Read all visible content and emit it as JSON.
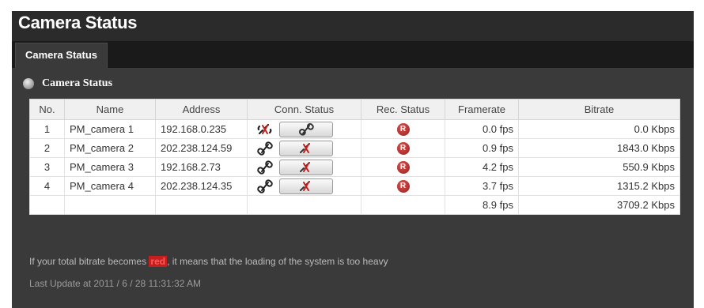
{
  "app": {
    "title": "Camera Status"
  },
  "tabs": [
    {
      "label": "Camera Status",
      "active": true
    }
  ],
  "section": {
    "title": "Camera Status"
  },
  "table": {
    "headers": [
      "No.",
      "Name",
      "Address",
      "Conn. Status",
      "Rec. Status",
      "Framerate",
      "Bitrate"
    ],
    "rows": [
      {
        "no": "1",
        "name": "PM_camera 1",
        "address": "192.168.0.235",
        "conn_state": "disconnected",
        "button_action": "connect",
        "rec": "R",
        "framerate": "0.0 fps",
        "bitrate": "0.0 Kbps"
      },
      {
        "no": "2",
        "name": "PM_camera 2",
        "address": "202.238.124.59",
        "conn_state": "connected",
        "button_action": "disconnect",
        "rec": "R",
        "framerate": "0.9 fps",
        "bitrate": "1843.0 Kbps"
      },
      {
        "no": "3",
        "name": "PM_camera 3",
        "address": "192.168.2.73",
        "conn_state": "connected",
        "button_action": "disconnect",
        "rec": "R",
        "framerate": "4.2 fps",
        "bitrate": "550.9 Kbps"
      },
      {
        "no": "4",
        "name": "PM_camera 4",
        "address": "202.238.124.35",
        "conn_state": "connected",
        "button_action": "disconnect",
        "rec": "R",
        "framerate": "3.7 fps",
        "bitrate": "1315.2 Kbps"
      }
    ],
    "totals": {
      "framerate": "8.9 fps",
      "bitrate": "3709.2 Kbps"
    }
  },
  "note": {
    "before": "If your total bitrate becomes ",
    "red_word": "red",
    "after": ", it means that the loading of the system is too heavy"
  },
  "last_update": "Last Update at 2011 / 6 / 28   11:31:32 AM",
  "colors": {
    "background": "#2b2b2b",
    "panel": "#3a3a3a",
    "rec": "#a52424",
    "alert": "#c41f1f"
  },
  "icons": {
    "connected": "link-icon",
    "disconnected": "broken-link-icon",
    "recording": "rec-icon"
  }
}
